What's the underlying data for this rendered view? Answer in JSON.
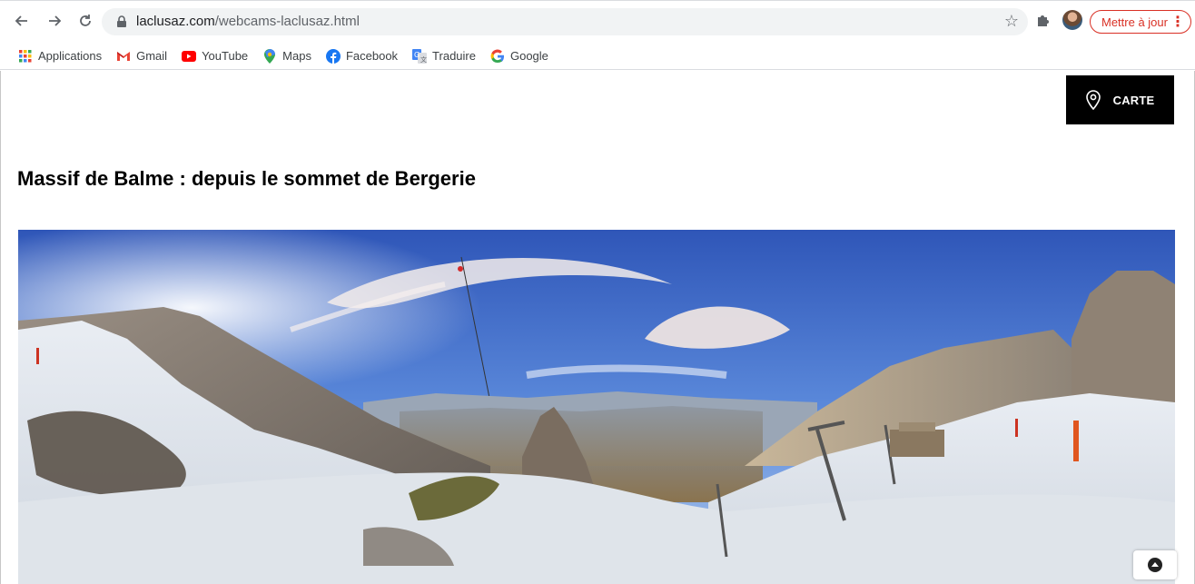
{
  "browser": {
    "url_domain": "laclusaz.com",
    "url_path": "/webcams-laclusaz.html",
    "update_button_label": "Mettre à jour"
  },
  "bookmarks": [
    {
      "label": "Applications",
      "icon": "apps-grid-icon"
    },
    {
      "label": "Gmail",
      "icon": "gmail-icon"
    },
    {
      "label": "YouTube",
      "icon": "youtube-icon"
    },
    {
      "label": "Maps",
      "icon": "maps-icon"
    },
    {
      "label": "Facebook",
      "icon": "facebook-icon"
    },
    {
      "label": "Traduire",
      "icon": "translate-icon"
    },
    {
      "label": "Google",
      "icon": "google-icon"
    }
  ],
  "page": {
    "map_button_label": "CARTE",
    "title": "Massif de Balme : depuis le sommet de Bergerie"
  },
  "colors": {
    "update_accent": "#d93025",
    "map_button_bg": "#000000"
  }
}
